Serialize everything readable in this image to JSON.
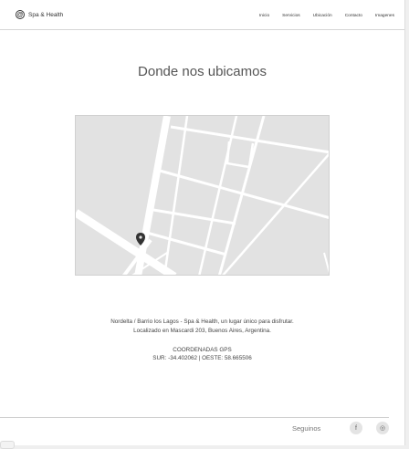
{
  "brand": {
    "name": "Spa & Health",
    "icon": "at-icon"
  },
  "nav": [
    "Inicio",
    "Servicios",
    "Ubicación",
    "Contacto",
    "Imagenes"
  ],
  "section_title": "Donde nos ubicamos",
  "map": {
    "icon": "map-pin-icon"
  },
  "info": {
    "line1": "Nordelta / Barrio los Lagos - Spa & Health, un lugar único para disfrutar.",
    "line2": "Localizado en Mascardi 203, Buenos Aires, Argentina.",
    "coords_title": "COORDENADAS GPS",
    "coords": "SUR: -34.402062 | OESTE: 58.665506"
  },
  "footer": {
    "follow_label": "Seguinos",
    "social": [
      {
        "name": "facebook-icon",
        "glyph": "f"
      },
      {
        "name": "instagram-icon",
        "glyph": "◎"
      }
    ]
  }
}
